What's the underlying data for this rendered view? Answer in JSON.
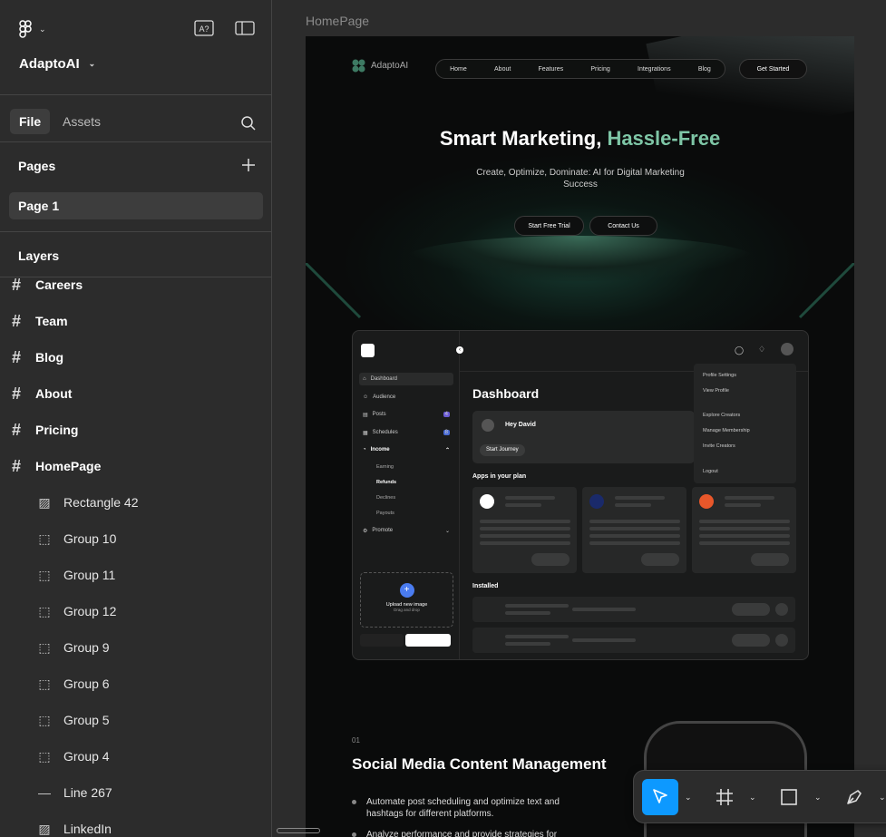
{
  "sidebar": {
    "project_name": "AdaptoAI",
    "tabs": {
      "file": "File",
      "assets": "Assets"
    },
    "pages_title": "Pages",
    "pages": [
      "Page 1"
    ],
    "layers_title": "Layers",
    "layers": [
      {
        "name": "Careers",
        "kind": "frame"
      },
      {
        "name": "Team",
        "kind": "frame"
      },
      {
        "name": "Blog",
        "kind": "frame"
      },
      {
        "name": "About",
        "kind": "frame"
      },
      {
        "name": "Pricing",
        "kind": "frame"
      },
      {
        "name": "HomePage",
        "kind": "frame"
      },
      {
        "name": "Rectangle 42",
        "kind": "image"
      },
      {
        "name": "Group 10",
        "kind": "group"
      },
      {
        "name": "Group 11",
        "kind": "group"
      },
      {
        "name": "Group 12",
        "kind": "group"
      },
      {
        "name": "Group 9",
        "kind": "group"
      },
      {
        "name": "Group 6",
        "kind": "group"
      },
      {
        "name": "Group 5",
        "kind": "group"
      },
      {
        "name": "Group 4",
        "kind": "group"
      },
      {
        "name": "Line 267",
        "kind": "line"
      },
      {
        "name": "LinkedIn",
        "kind": "image"
      }
    ]
  },
  "canvas": {
    "frame_label": "HomePage",
    "site": {
      "brand": "AdaptoAI",
      "nav": [
        "Home",
        "About",
        "Features",
        "Pricing",
        "Integrations",
        "Blog"
      ],
      "get_started": "Get Started",
      "hero_title_a": "Smart Marketing,",
      "hero_title_b": "Hassle-Free",
      "hero_sub": "Create, Optimize, Dominate: AI for Digital Marketing Success",
      "cta_trial": "Start Free Trial",
      "cta_contact": "Contact Us",
      "dashboard": {
        "menu": [
          "Dashboard",
          "Audience",
          "Posts",
          "Schedules",
          "Income",
          "Promote"
        ],
        "income_sub": [
          "Earning",
          "Refunds",
          "Declines",
          "Payouts"
        ],
        "posts_badge": "4",
        "schedules_badge": "8",
        "title": "Dashboard",
        "greeting": "Hey David",
        "start_journey": "Start Journey",
        "apps_label": "Apps in your plan",
        "installed_label": "Installed",
        "upload_title": "Upload new image",
        "upload_sub": "Drag and drop",
        "dropdown": [
          "Profile Settings",
          "View Profile",
          "Explore Creators",
          "Manage Membership",
          "Invite Creators",
          "Logout"
        ]
      },
      "section_num": "01",
      "section_title": "Social Media Content Management",
      "bullets": [
        "Automate post scheduling and optimize text and hashtags for different platforms.",
        "Analyze performance and provide strategies for"
      ]
    }
  },
  "colors": {
    "accent": "#7ec6a6",
    "select": "#0d99ff",
    "panel": "#2c2c2c"
  }
}
